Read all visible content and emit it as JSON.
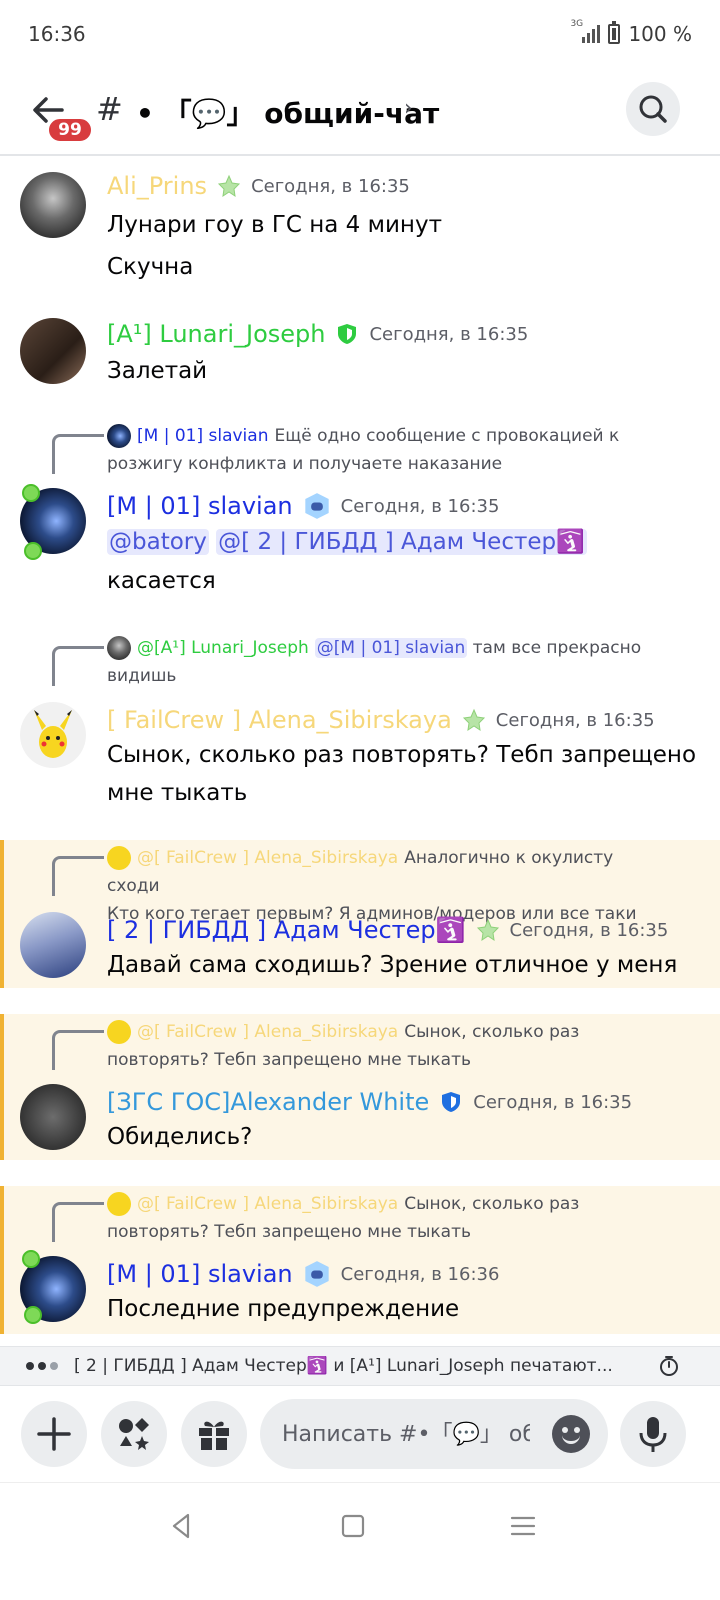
{
  "status": {
    "time": "16:36",
    "network": "3G",
    "battery": "100 %"
  },
  "header": {
    "unread_badge": "99",
    "hash": "#",
    "channel": "• 「💬」 общий-чат",
    "chevron": "›"
  },
  "messages": [
    {
      "author": "Ali_Prins",
      "color": "#f6d77a",
      "time": "Сегодня, в 16:35",
      "lines": [
        "Лунари гоу  в ГС на 4 минут",
        "Скучна"
      ]
    },
    {
      "author": "[A¹] Lunari_Joseph",
      "color": "#2ecc40",
      "time": "Сегодня, в 16:35",
      "lines": [
        "Залетай"
      ]
    },
    {
      "author": "[M | 01] slavian",
      "color": "#1c2fe0",
      "time": "Сегодня, в 16:35",
      "reply": {
        "author": "[M | 01] slavian",
        "text": "Ещё одно сообщение с провокацией к",
        "text2": "розжигу конфликта и получаете наказание"
      },
      "mentions": [
        "@batory",
        "@[ 2 | ГИБДД ] Адам Честер🛐"
      ],
      "lines": [
        "касается"
      ]
    },
    {
      "author": "[ FailCrew ] Alena_Sibirskaya",
      "color": "#f6d77a",
      "time": "Сегодня, в 16:35",
      "reply": {
        "author": "@[A¹] Lunari_Joseph",
        "mention": "@[M | 01] slavian",
        "text": "там все прекрасно",
        "text2": "видишь"
      },
      "lines": [
        "Сынок, сколько раз повторять? Тебп запрещено",
        "мне тыкать"
      ]
    },
    {
      "author": "[ 2 | ГИБДД ] Адам Честер🛐",
      "color": "#1c2fe0",
      "time": "Сегодня, в 16:35",
      "reply": {
        "author": "@[ FailCrew ] Alena_Sibirskaya",
        "text": "Аналогично к окулисту сходи",
        "text2": "Кто кого тегает первым? Я админов/модеров или все таки"
      },
      "lines": [
        "Давай сама сходишь? Зрение отличное у меня"
      ]
    },
    {
      "author": "[ЗГС ГОС]Alexander White",
      "color": "#3498db",
      "time": "Сегодня, в 16:35",
      "reply": {
        "author": "@[ FailCrew ] Alena_Sibirskaya",
        "text": "Сынок, сколько раз",
        "text2": "повторять? Тебп запрещено мне тыкать"
      },
      "lines": [
        "Обиделись?"
      ]
    },
    {
      "author": "[M | 01] slavian",
      "color": "#1c2fe0",
      "time": "Сегодня, в 16:36",
      "reply": {
        "author": "@[ FailCrew ] Alena_Sibirskaya",
        "text": "Сынок, сколько раз",
        "text2": "повторять? Тебп запрещено мне тыкать"
      },
      "lines": [
        "Последние предупреждение"
      ]
    }
  ],
  "typing": "[ 2 | ГИБДД ] Адам Честер🛐 и [A¹] Lunari_Joseph печатают...",
  "composer": {
    "placeholder": "Написать #•「💬」 общий-чат"
  },
  "icons": [
    "arrow-left",
    "search",
    "plus",
    "apps",
    "gift",
    "emoji",
    "microphone",
    "timer",
    "nav-back",
    "nav-home",
    "nav-menu"
  ]
}
